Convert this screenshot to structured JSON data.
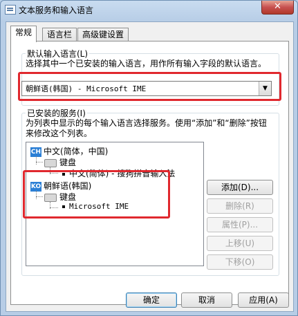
{
  "window": {
    "title": "文本服务和输入语言",
    "close_glyph": "✕"
  },
  "tabs": [
    {
      "label": "常规",
      "active": true
    },
    {
      "label": "语言栏",
      "active": false
    },
    {
      "label": "高级键设置",
      "active": false
    }
  ],
  "default_language": {
    "group_label": "默认输入语言(L)",
    "description": "选择其中一个已安装的输入语言，用作所有输入字段的默认语言。",
    "selected": "朝鲜语(韩国) - Microsoft IME",
    "arrow_glyph": "▼"
  },
  "installed_services": {
    "group_label": "已安装的服务(I)",
    "description": "为列表中显示的每个输入语言选择服务。使用“添加”和“删除”按钮来修改这个列表。",
    "languages": [
      {
        "badge": "CH",
        "name": "中文(简体，中国)",
        "category": "键盘",
        "service": "中文(简体) - 搜狗拼音输入法"
      },
      {
        "badge": "KO",
        "name": "朝鲜语(韩国)",
        "category": "键盘",
        "service": "Microsoft IME"
      }
    ]
  },
  "side_buttons": {
    "add": "添加(D)...",
    "remove": "删除(R)",
    "properties": "属性(P)...",
    "move_up": "上移(U)",
    "move_down": "下移(O)"
  },
  "footer_buttons": {
    "ok": "确定",
    "cancel": "取消",
    "apply": "应用(A)"
  },
  "colors": {
    "highlight": "#e0282e",
    "language_badge": "#2b7fd5"
  }
}
